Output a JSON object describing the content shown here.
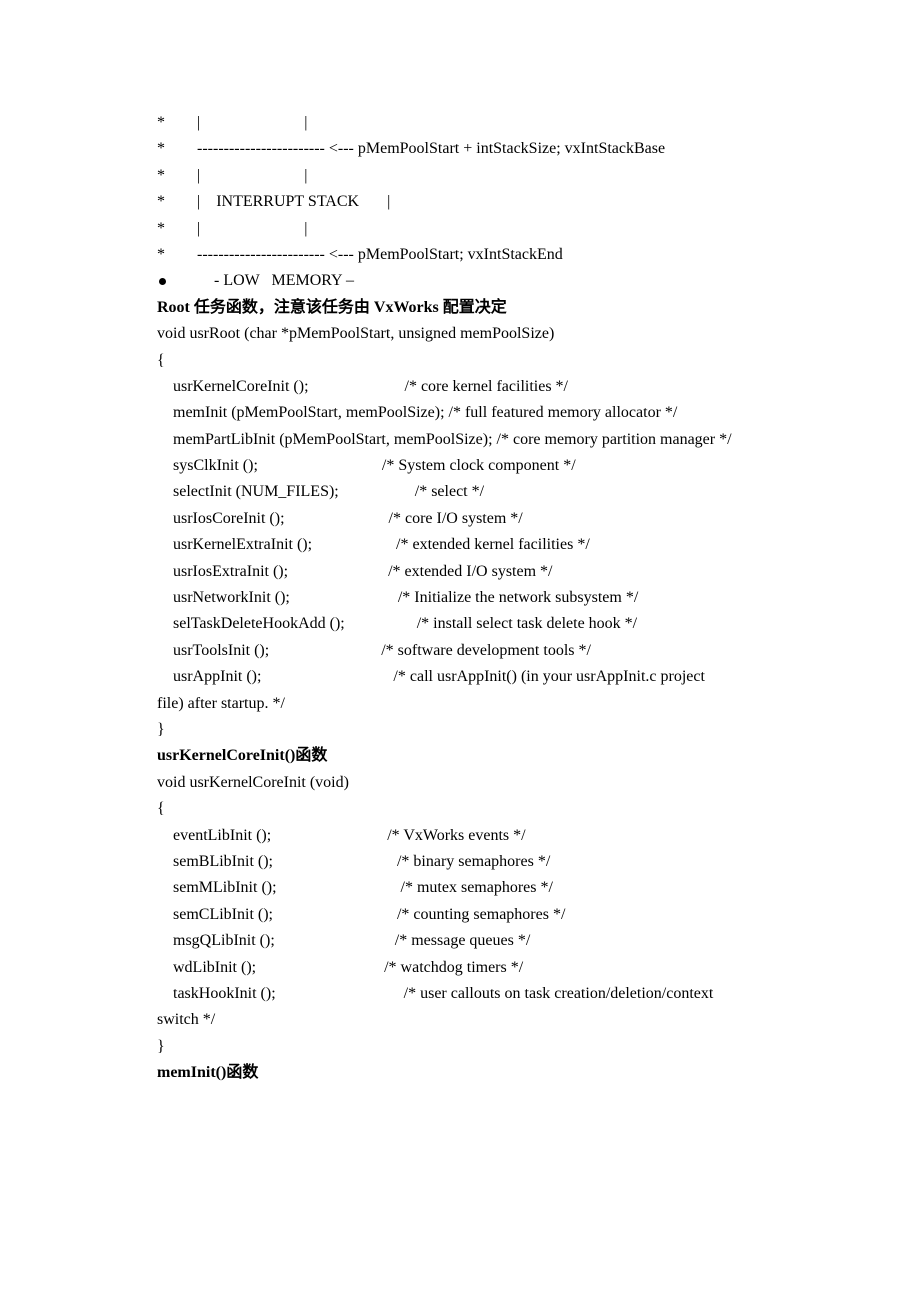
{
  "diagram": {
    "l1": "*        |                          |",
    "l2": "*        ------------------------ <--- pMemPoolStart + intStackSize; vxIntStackBase",
    "l3": "*        |                          |",
    "l4": "*        |    INTERRUPT STACK       |",
    "l5": "*        |                          |",
    "l6": "*        ------------------------ <--- pMemPoolStart; vxIntStackEnd",
    "bullet": "- LOW   MEMORY –"
  },
  "heading1": "Root 任务函数，注意该任务由 VxWorks 配置决定",
  "code1": {
    "l1": "void usrRoot (char *pMemPoolStart, unsigned memPoolSize)",
    "l2": "{",
    "l3": "    usrKernelCoreInit ();                        /* core kernel facilities */",
    "l4": "    memInit (pMemPoolStart, memPoolSize); /* full featured memory allocator */",
    "l5": "    memPartLibInit (pMemPoolStart, memPoolSize); /* core memory partition manager */",
    "l6": "    sysClkInit ();                               /* System clock component */",
    "l7": "    selectInit (NUM_FILES);                   /* select */",
    "l8": "    usrIosCoreInit ();                          /* core I/O system */",
    "l9": "    usrKernelExtraInit ();                     /* extended kernel facilities */",
    "l10": "    usrIosExtraInit ();                         /* extended I/O system */",
    "l11": "    usrNetworkInit ();                           /* Initialize the network subsystem */",
    "l12": "    selTaskDeleteHookAdd ();                  /* install select task delete hook */",
    "l13": "    usrToolsInit ();                            /* software development tools */",
    "l14": "    usrAppInit ();                                 /* call usrAppInit() (in your usrAppInit.c project",
    "l15": "file) after startup. */",
    "l16": "}"
  },
  "heading2": "usrKernelCoreInit()函数",
  "code2": {
    "l1": "void usrKernelCoreInit (void)",
    "l2": "{",
    "l3": "    eventLibInit ();                             /* VxWorks events */",
    "l4": "    semBLibInit ();                               /* binary semaphores */",
    "l5": "    semMLibInit ();                               /* mutex semaphores */",
    "l6": "    semCLibInit ();                               /* counting semaphores */",
    "l7": "    msgQLibInit ();                              /* message queues */",
    "l8": "    wdLibInit ();                                /* watchdog timers */",
    "l9": "    taskHookInit ();                                /* user callouts on task creation/deletion/context",
    "l10": "switch */",
    "l11": "}"
  },
  "heading3": "memInit()函数"
}
